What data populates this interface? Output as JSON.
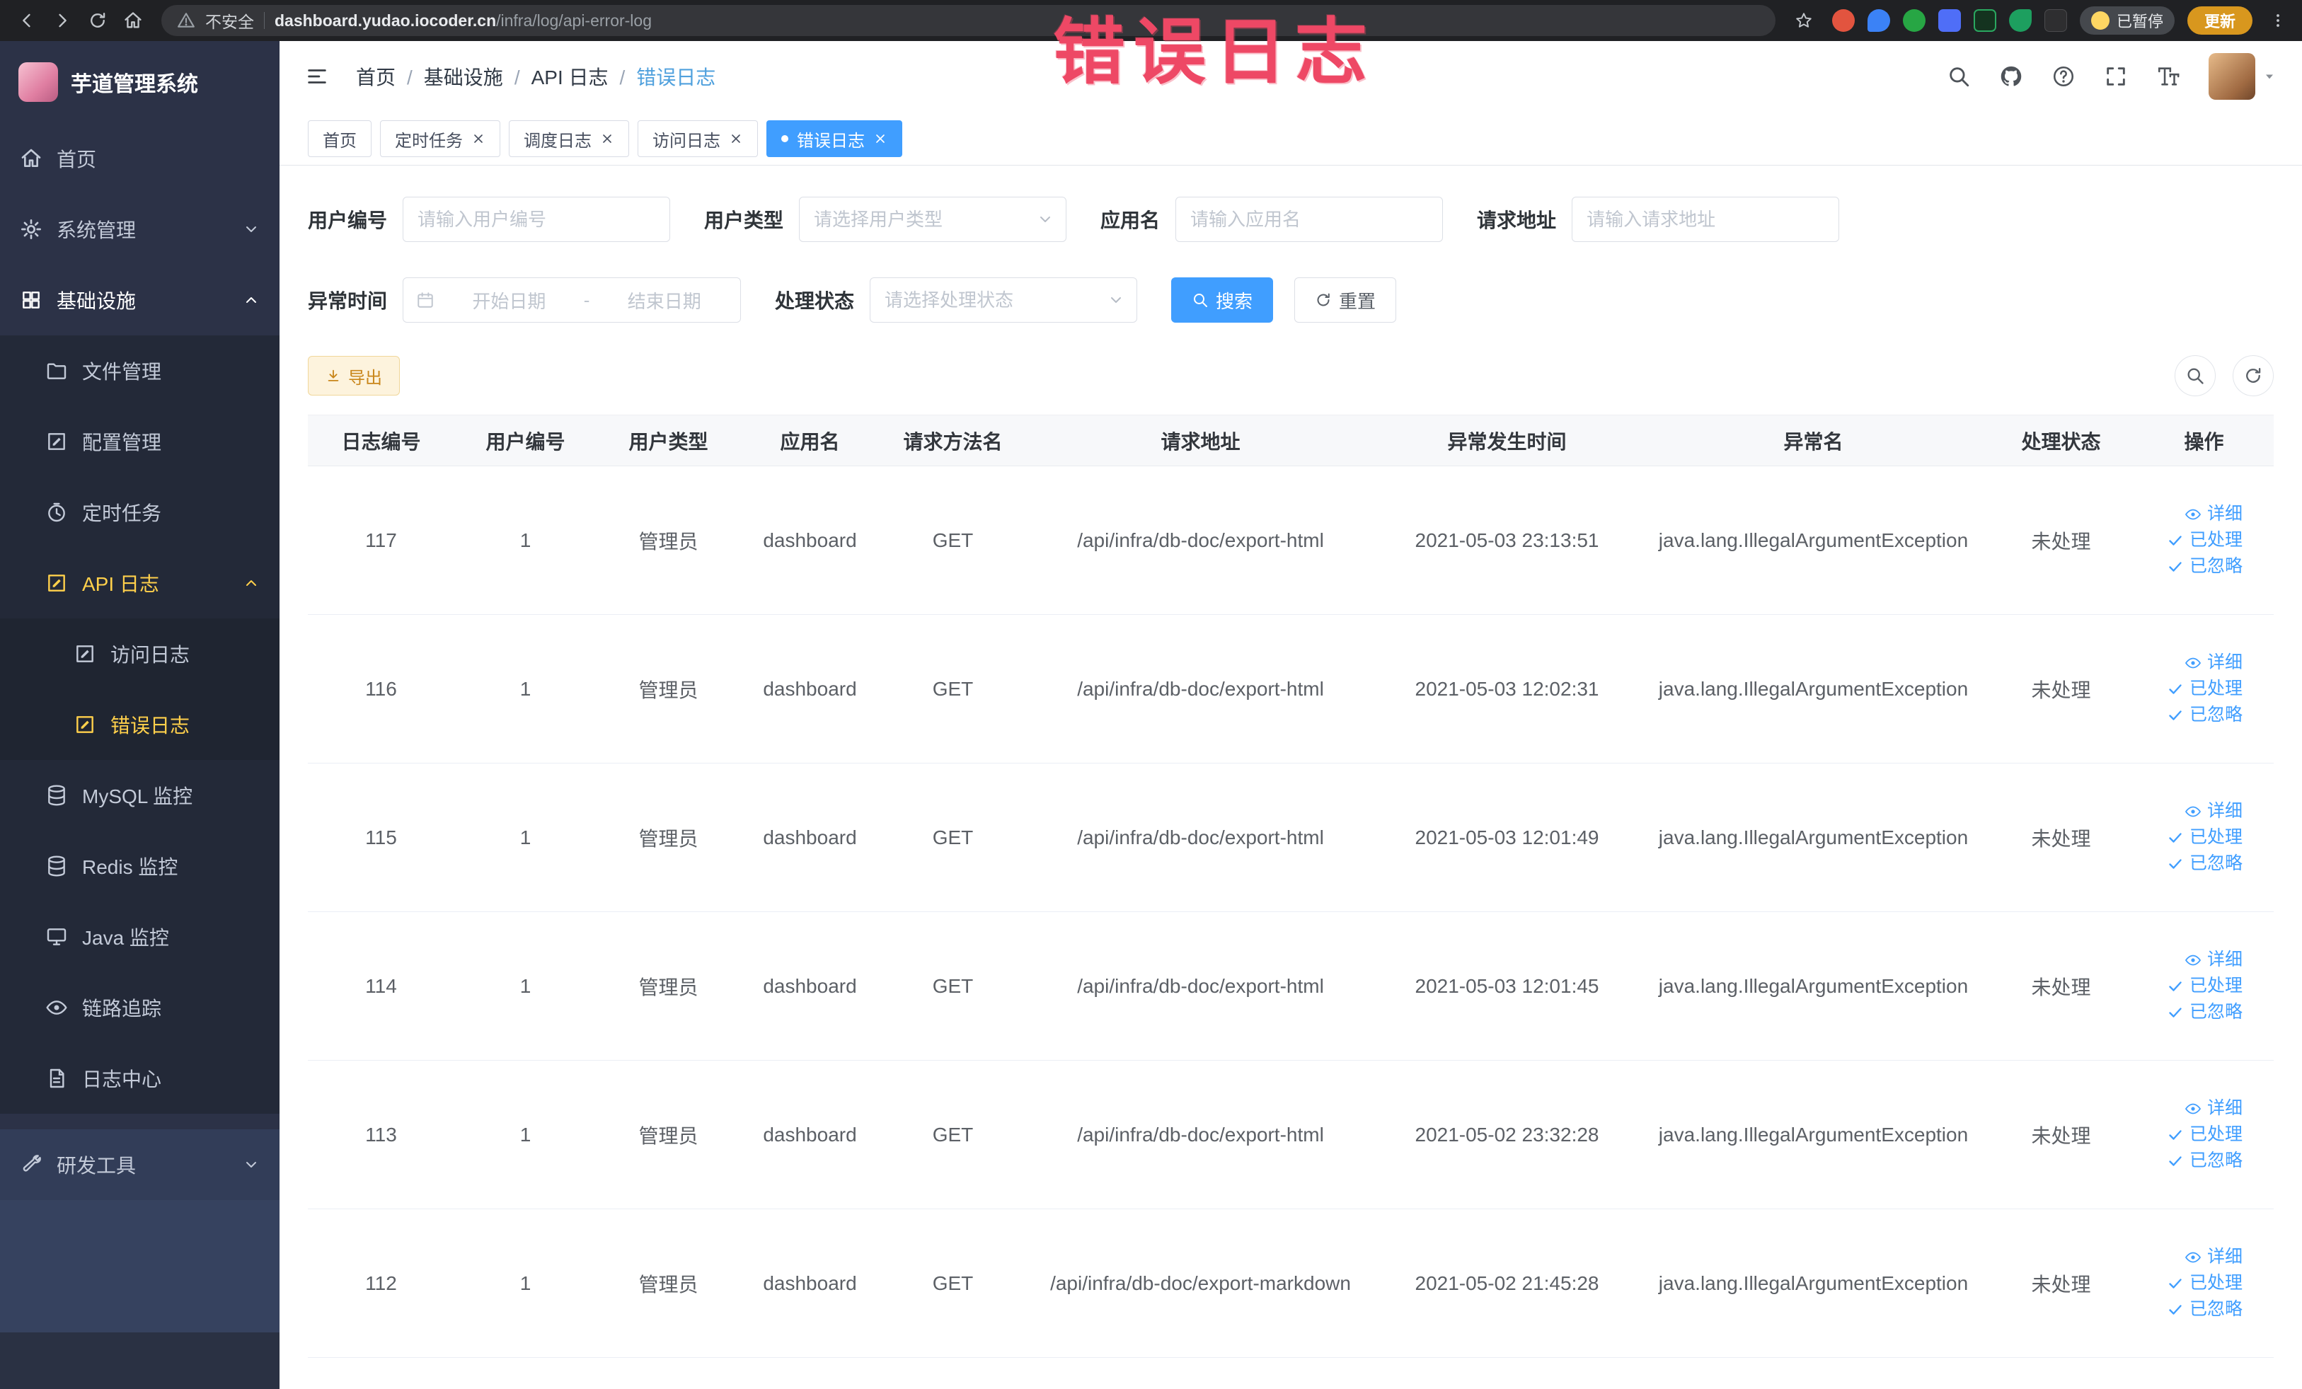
{
  "browser": {
    "security_label": "不安全",
    "url_host": "dashboard.yudao.iocoder.cn",
    "url_path": "/infra/log/api-error-log",
    "paused_label": "已暂停",
    "update_label": "更新"
  },
  "annotation": {
    "text": "错误日志",
    "color": "#ee4865"
  },
  "sidebar": {
    "title": "芋道管理系统",
    "items": [
      {
        "label": "首页"
      },
      {
        "label": "系统管理"
      },
      {
        "label": "基础设施"
      },
      {
        "label": "文件管理"
      },
      {
        "label": "配置管理"
      },
      {
        "label": "定时任务"
      },
      {
        "label": "API 日志"
      },
      {
        "label": "访问日志"
      },
      {
        "label": "错误日志"
      },
      {
        "label": "MySQL 监控"
      },
      {
        "label": "Redis 监控"
      },
      {
        "label": "Java 监控"
      },
      {
        "label": "链路追踪"
      },
      {
        "label": "日志中心"
      },
      {
        "label": "研发工具"
      }
    ]
  },
  "header": {
    "breadcrumb": [
      "首页",
      "基础设施",
      "API 日志",
      "错误日志"
    ]
  },
  "tabs": [
    {
      "label": "首页"
    },
    {
      "label": "定时任务"
    },
    {
      "label": "调度日志"
    },
    {
      "label": "访问日志"
    },
    {
      "label": "错误日志"
    }
  ],
  "filters": {
    "user_id_label": "用户编号",
    "user_id_placeholder": "请输入用户编号",
    "user_type_label": "用户类型",
    "user_type_placeholder": "请选择用户类型",
    "app_name_label": "应用名",
    "app_name_placeholder": "请输入应用名",
    "request_url_label": "请求地址",
    "request_url_placeholder": "请输入请求地址",
    "exception_time_label": "异常时间",
    "start_date_placeholder": "开始日期",
    "range_separator": "-",
    "end_date_placeholder": "结束日期",
    "process_status_label": "处理状态",
    "process_status_placeholder": "请选择处理状态",
    "search_label": "搜索",
    "reset_label": "重置"
  },
  "toolbar": {
    "export_label": "导出"
  },
  "table": {
    "columns": [
      "日志编号",
      "用户编号",
      "用户类型",
      "应用名",
      "请求方法名",
      "请求地址",
      "异常发生时间",
      "异常名",
      "处理状态",
      "操作"
    ],
    "actions": {
      "detail": "详细",
      "done": "已处理",
      "ignore": "已忽略"
    },
    "rows": [
      {
        "id": "117",
        "user_id": "1",
        "user_type": "管理员",
        "app": "dashboard",
        "method": "GET",
        "url": "/api/infra/db-doc/export-html",
        "time": "2021-05-03 23:13:51",
        "exception": "java.lang.IllegalArgumentException",
        "status": "未处理"
      },
      {
        "id": "116",
        "user_id": "1",
        "user_type": "管理员",
        "app": "dashboard",
        "method": "GET",
        "url": "/api/infra/db-doc/export-html",
        "time": "2021-05-03 12:02:31",
        "exception": "java.lang.IllegalArgumentException",
        "status": "未处理"
      },
      {
        "id": "115",
        "user_id": "1",
        "user_type": "管理员",
        "app": "dashboard",
        "method": "GET",
        "url": "/api/infra/db-doc/export-html",
        "time": "2021-05-03 12:01:49",
        "exception": "java.lang.IllegalArgumentException",
        "status": "未处理"
      },
      {
        "id": "114",
        "user_id": "1",
        "user_type": "管理员",
        "app": "dashboard",
        "method": "GET",
        "url": "/api/infra/db-doc/export-html",
        "time": "2021-05-03 12:01:45",
        "exception": "java.lang.IllegalArgumentException",
        "status": "未处理"
      },
      {
        "id": "113",
        "user_id": "1",
        "user_type": "管理员",
        "app": "dashboard",
        "method": "GET",
        "url": "/api/infra/db-doc/export-html",
        "time": "2021-05-02 23:32:28",
        "exception": "java.lang.IllegalArgumentException",
        "status": "未处理"
      },
      {
        "id": "112",
        "user_id": "1",
        "user_type": "管理员",
        "app": "dashboard",
        "method": "GET",
        "url": "/api/infra/db-doc/export-markdown",
        "time": "2021-05-02 21:45:28",
        "exception": "java.lang.IllegalArgumentException",
        "status": "未处理"
      }
    ]
  }
}
